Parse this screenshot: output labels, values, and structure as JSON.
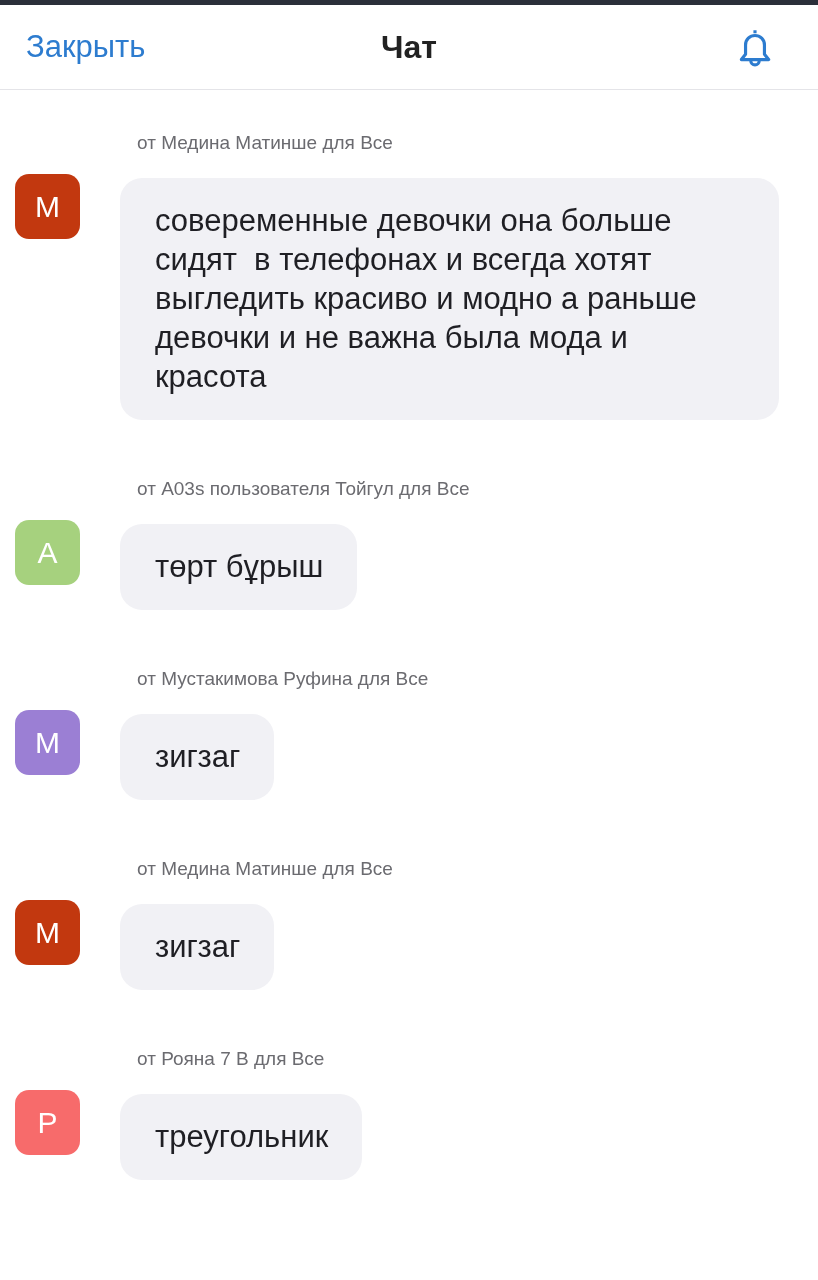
{
  "header": {
    "close_label": "Закрыть",
    "title": "Чат"
  },
  "messages": [
    {
      "sender": "от Медина Матинше для Все",
      "initial": "М",
      "color": "#c2380f",
      "text": "совеременные девочки она больше сидят  в телефонах и всегда хотят выгледить красиво и модно а раньше девочки и не важна была мода и красота"
    },
    {
      "sender": "от A03s пользователя Тойгул для Все",
      "initial": "А",
      "color": "#a6d17e",
      "text": "төрт бұрыш"
    },
    {
      "sender": "от Мустакимова Руфина для Все",
      "initial": "М",
      "color": "#9b7fd4",
      "text": "зигзаг"
    },
    {
      "sender": "от Медина Матинше для Все",
      "initial": "М",
      "color": "#c2380f",
      "text": "зигзаг"
    },
    {
      "sender": "от Рояна 7 В для Все",
      "initial": "Р",
      "color": "#f76b6b",
      "text": "треугольник"
    }
  ]
}
